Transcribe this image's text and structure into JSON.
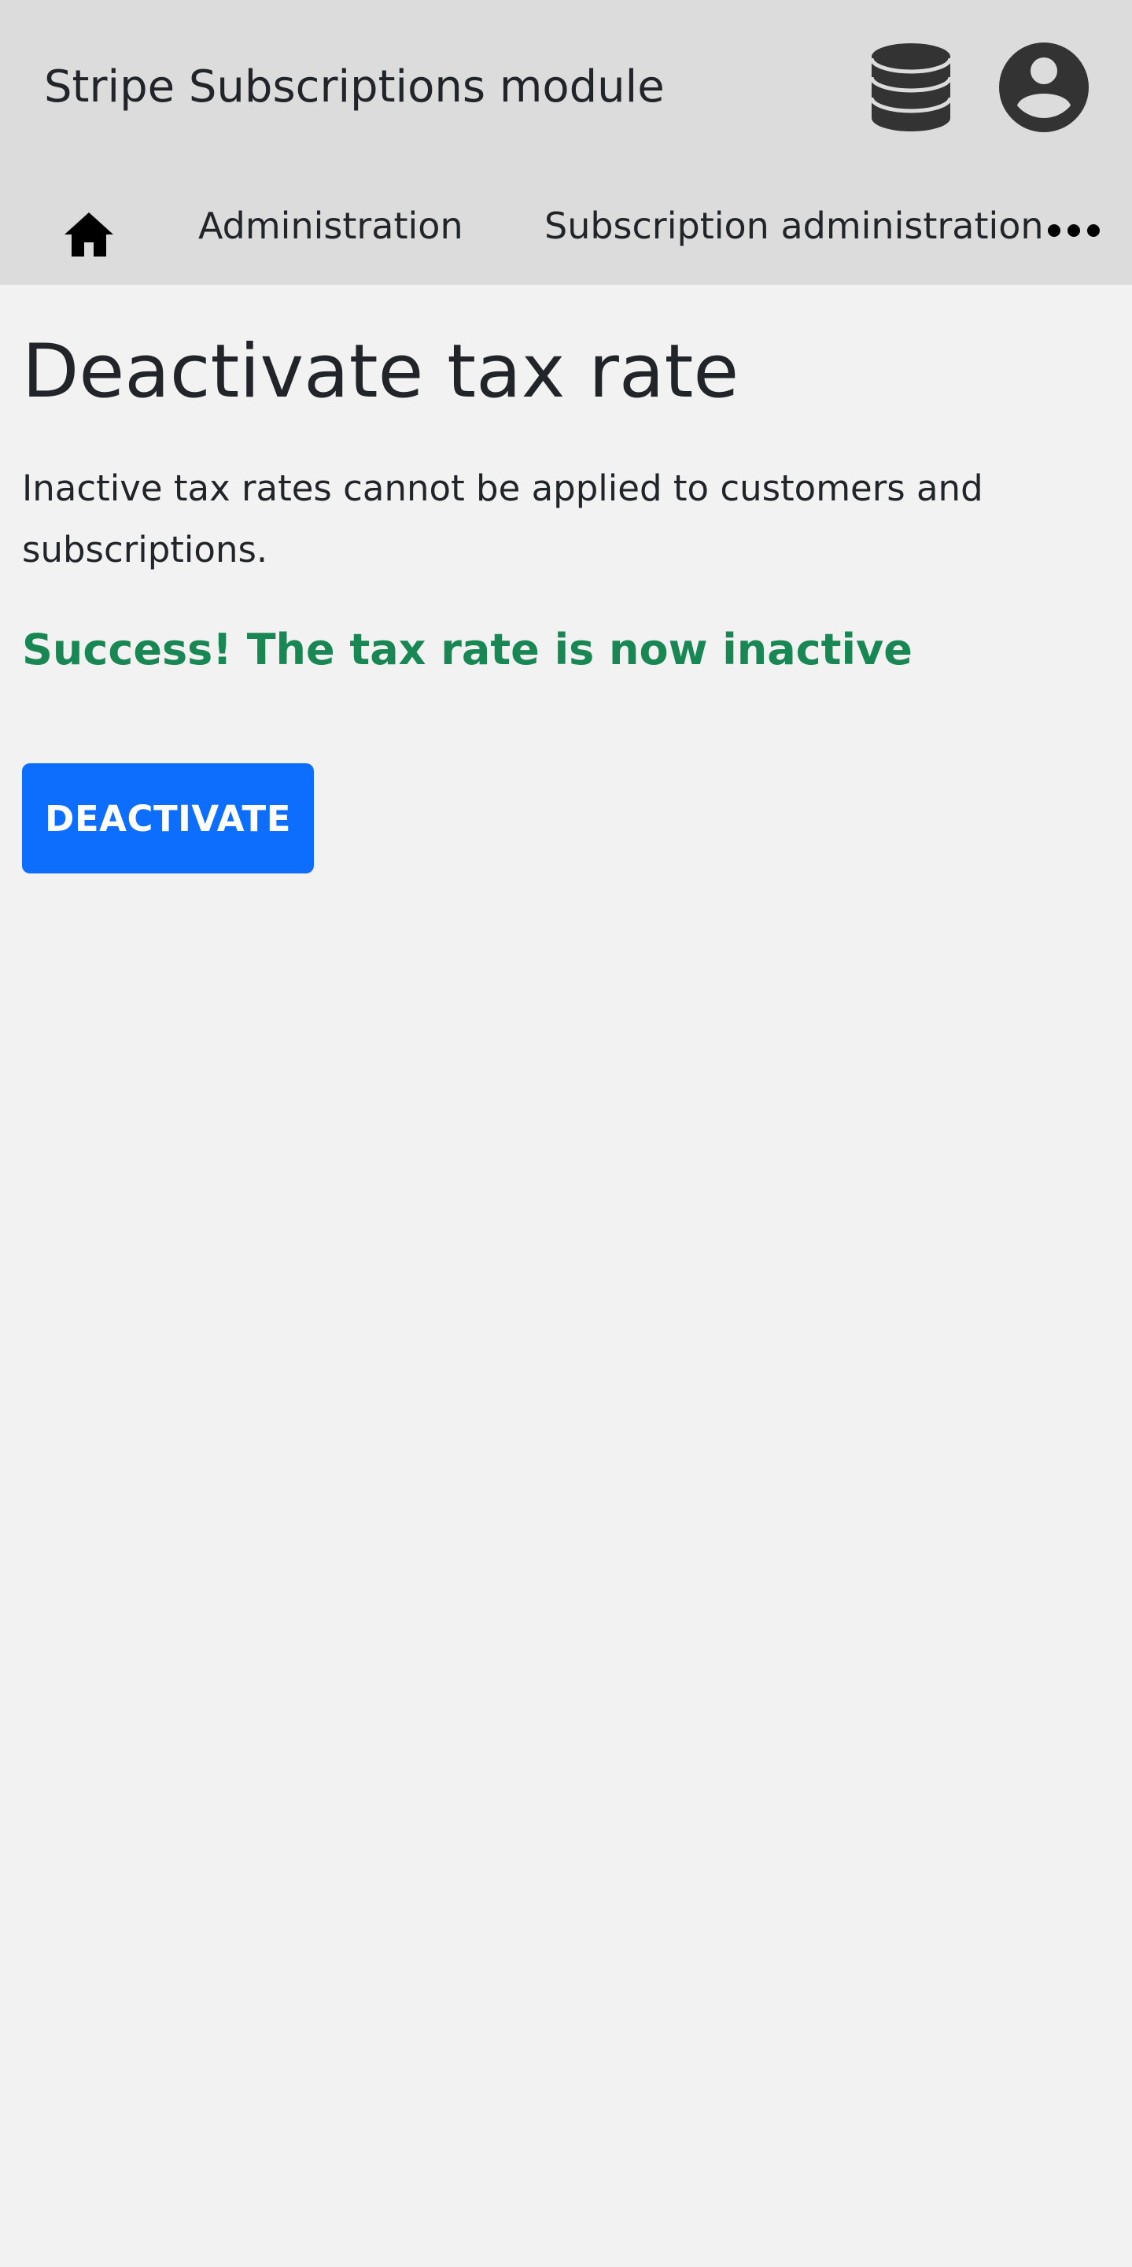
{
  "header": {
    "app_title": "Stripe Subscriptions module",
    "database_icon": "database-icon",
    "user_icon": "user-circle-icon"
  },
  "nav": {
    "home_icon": "home-icon",
    "items": [
      {
        "label": "Administration"
      },
      {
        "label": "Subscription administration"
      }
    ],
    "more_icon": "ellipsis-icon"
  },
  "page": {
    "title": "Deactivate tax rate",
    "description": "Inactive tax rates cannot be applied to customers and subscriptions.",
    "success_message": "Success! The tax rate is now inactive",
    "button_label": "DEACTIVATE"
  },
  "colors": {
    "header_bg": "#dcdcdc",
    "page_bg": "#f2f2f2",
    "success": "#198754",
    "primary": "#0d6efd",
    "icon": "#333333"
  }
}
